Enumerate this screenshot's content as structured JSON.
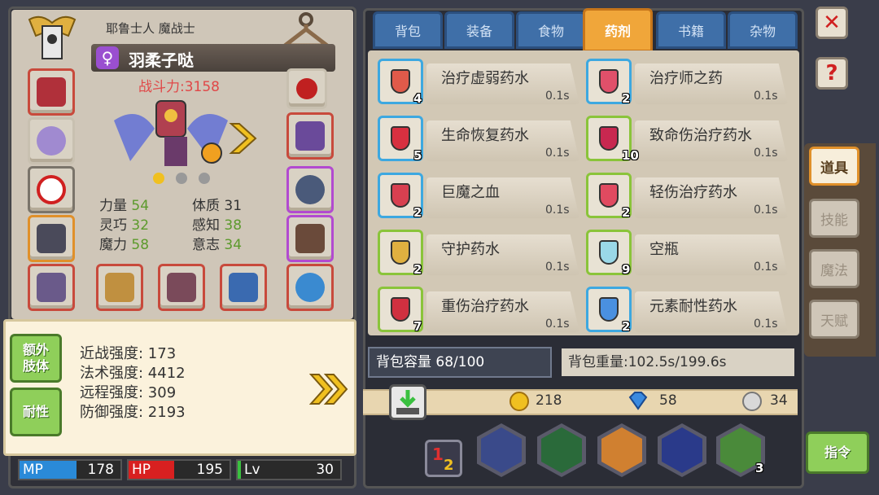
{
  "character": {
    "title": "耶鲁士人 魔战士",
    "name": "羽柔子哒",
    "gender_icon": "♀",
    "power": "战斗力:3158",
    "stats": [
      {
        "label": "力量",
        "value": "54"
      },
      {
        "label": "体质",
        "value": "31"
      },
      {
        "label": "灵巧",
        "value": "32"
      },
      {
        "label": "感知",
        "value": "38"
      },
      {
        "label": "魔力",
        "value": "58"
      },
      {
        "label": "意志",
        "value": "34"
      }
    ]
  },
  "info": {
    "btn_extra": "额外\n肢体",
    "btn_resist": "耐性",
    "lines": [
      "近战强度: 173",
      "法术强度: 4412",
      "远程强度: 309",
      "防御强度: 2193"
    ]
  },
  "bars": {
    "mp_label": "MP",
    "mp_value": "178",
    "hp_label": "HP",
    "hp_value": "195",
    "lv_label": "Lv",
    "lv_value": "30"
  },
  "tabs": [
    "背包",
    "装备",
    "食物",
    "药剂",
    "书籍",
    "杂物"
  ],
  "active_tab": "药剂",
  "items": [
    {
      "name": "治疗虚弱药水",
      "count": "4",
      "weight": "0.1s",
      "color": "#e05a4a",
      "border": "blue"
    },
    {
      "name": "治疗师之药",
      "count": "2",
      "weight": "0.1s",
      "color": "#e0506a",
      "border": "blue"
    },
    {
      "name": "生命恢复药水",
      "count": "5",
      "weight": "0.1s",
      "color": "#d83040",
      "border": "blue"
    },
    {
      "name": "致命伤治疗药水",
      "count": "10",
      "weight": "0.1s",
      "color": "#c82850",
      "border": "green"
    },
    {
      "name": "巨魔之血",
      "count": "2",
      "weight": "0.1s",
      "color": "#d84050",
      "border": "blue"
    },
    {
      "name": "轻伤治疗药水",
      "count": "2",
      "weight": "0.1s",
      "color": "#e04a60",
      "border": "green"
    },
    {
      "name": "守护药水",
      "count": "2",
      "weight": "0.1s",
      "color": "#e0b040",
      "border": "green"
    },
    {
      "name": "空瓶",
      "count": "9",
      "weight": "0.1s",
      "color": "#9ad8e8",
      "border": "green"
    },
    {
      "name": "重伤治疗药水",
      "count": "7",
      "weight": "0.1s",
      "color": "#d03040",
      "border": "green"
    },
    {
      "name": "元素耐性药水",
      "count": "2",
      "weight": "0.1s",
      "color": "#4a90e0",
      "border": "blue"
    }
  ],
  "capacity": "背包容量 68/100",
  "weight": "背包重量:102.5s/199.6s",
  "currency": {
    "gold": "218",
    "gem": "58",
    "silver": "34"
  },
  "right_tabs": [
    "道具",
    "技能",
    "魔法",
    "天赋"
  ],
  "command_btn": "指令",
  "skill_badge": "3",
  "colors": {
    "accent": "#f0a63a",
    "tab_blue": "#3f6fa8",
    "green": "#8fcf5a",
    "power_red": "#e04848"
  }
}
